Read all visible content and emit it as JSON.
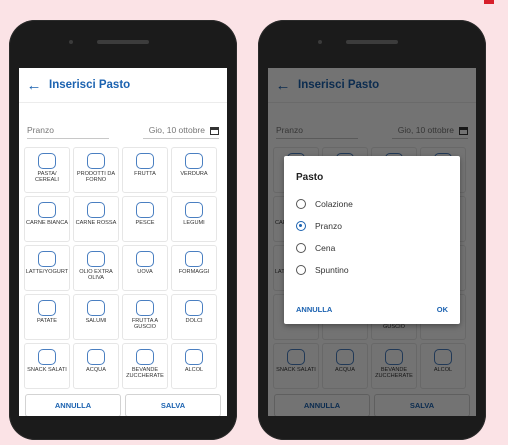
{
  "left": {
    "title": "Inserisci Pasto",
    "back_icon": "arrow-left-icon",
    "meal_field": "Pranzo",
    "date": "Gio, 10 ottobre",
    "categories": [
      {
        "label": "PASTA/ CEREALI",
        "icon": "wheat-icon"
      },
      {
        "label": "PRODOTTI DA FORNO",
        "icon": "bread-icon"
      },
      {
        "label": "FRUTTA",
        "icon": "apple-icon"
      },
      {
        "label": "VERDURA",
        "icon": "broccoli-icon"
      },
      {
        "label": "CARNE BIANCA",
        "icon": "drumstick-icon"
      },
      {
        "label": "CARNE ROSSA",
        "icon": "steak-icon"
      },
      {
        "label": "PESCE",
        "icon": "fish-icon"
      },
      {
        "label": "LEGUMI",
        "icon": "pea-icon"
      },
      {
        "label": "LATTE/YOGURT",
        "icon": "milk-icon"
      },
      {
        "label": "OLIO EXTRA OLIVA",
        "icon": "oil-icon"
      },
      {
        "label": "UOVA",
        "icon": "egg-icon"
      },
      {
        "label": "FORMAGGI",
        "icon": "cheese-icon"
      },
      {
        "label": "PATATE",
        "icon": "potato-icon"
      },
      {
        "label": "SALUMI",
        "icon": "salami-icon"
      },
      {
        "label": "FRUTTA A GUSCIO",
        "icon": "nut-icon"
      },
      {
        "label": "DOLCI",
        "icon": "cupcake-icon"
      },
      {
        "label": "SNACK SALATI",
        "icon": "chips-icon"
      },
      {
        "label": "ACQUA",
        "icon": "glass-icon"
      },
      {
        "label": "BEVANDE ZUCCHERATE",
        "icon": "can-icon"
      },
      {
        "label": "ALCOL",
        "icon": "wine-icon"
      }
    ],
    "cancel": "ANNULLA",
    "save": "SALVA"
  },
  "right": {
    "dialog_title": "Pasto",
    "options": [
      {
        "label": "Colazione",
        "selected": false
      },
      {
        "label": "Pranzo",
        "selected": true
      },
      {
        "label": "Cena",
        "selected": false
      },
      {
        "label": "Spuntino",
        "selected": false
      }
    ],
    "dialog_cancel": "ANNULLA",
    "dialog_ok": "OK"
  },
  "colors": {
    "accent": "#1b62b0",
    "background": "#fbe3e6",
    "phone": "#1b1b1b"
  }
}
